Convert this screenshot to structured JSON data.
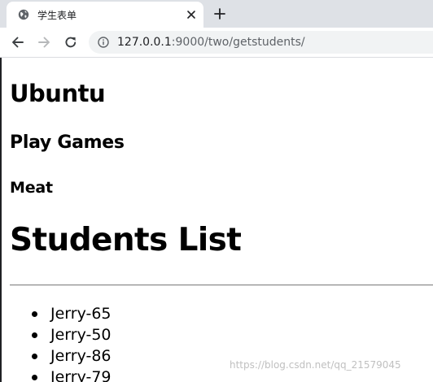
{
  "browser": {
    "tab": {
      "title": "学生表单",
      "favicon_icon": "globe-icon",
      "close_icon": "close-icon"
    },
    "new_tab_icon": "plus-icon",
    "toolbar": {
      "back_icon": "arrow-left-icon",
      "forward_icon": "arrow-right-icon",
      "reload_icon": "reload-icon",
      "info_icon": "info-icon"
    },
    "address": {
      "host": "127.0.0.1",
      "path": ":9000/two/getstudents/"
    }
  },
  "page": {
    "os": "Ubuntu",
    "hobby": "Play Games",
    "food": "Meat",
    "list_title": "Students List",
    "students": [
      "Jerry-65",
      "Jerry-50",
      "Jerry-86",
      "Jerry-79"
    ]
  },
  "watermark": "https://blog.csdn.net/qq_21579045",
  "colors": {
    "tabstrip": "#dee1e6",
    "omnibox": "#f1f3f4",
    "text": "#000000",
    "url_rest": "#5f6368"
  }
}
